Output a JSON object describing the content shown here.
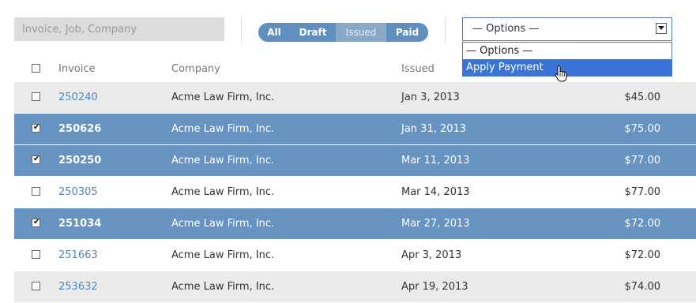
{
  "search": {
    "placeholder": "Invoice, Job, Company"
  },
  "filters": [
    {
      "label": "All",
      "active": false
    },
    {
      "label": "Draft",
      "active": false
    },
    {
      "label": "Issued",
      "active": true
    },
    {
      "label": "Paid",
      "active": false
    }
  ],
  "options": {
    "selected": "— Options —",
    "items": [
      "— Options —",
      "Apply Payment"
    ],
    "highlighted": "Apply Payment"
  },
  "columns": {
    "invoice": "Invoice",
    "company": "Company",
    "issued": "Issued"
  },
  "rows": [
    {
      "checked": false,
      "invoice": "250240",
      "company": "Acme Law Firm, Inc.",
      "issued": "Jan 3, 2013",
      "amount": "$45.00"
    },
    {
      "checked": true,
      "invoice": "250626",
      "company": "Acme Law Firm, Inc.",
      "issued": "Jan 31, 2013",
      "amount": "$75.00"
    },
    {
      "checked": true,
      "invoice": "250250",
      "company": "Acme Law Firm, Inc.",
      "issued": "Mar 11, 2013",
      "amount": "$77.00"
    },
    {
      "checked": false,
      "invoice": "250305",
      "company": "Acme Law Firm, Inc.",
      "issued": "Mar 14, 2013",
      "amount": "$77.00"
    },
    {
      "checked": true,
      "invoice": "251034",
      "company": "Acme Law Firm, Inc.",
      "issued": "Mar 27, 2013",
      "amount": "$72.00"
    },
    {
      "checked": false,
      "invoice": "251663",
      "company": "Acme Law Firm, Inc.",
      "issued": "Apr 3, 2013",
      "amount": "$72.00"
    },
    {
      "checked": false,
      "invoice": "253632",
      "company": "Acme Law Firm, Inc.",
      "issued": "Apr 19, 2013",
      "amount": "$74.00"
    }
  ],
  "colors": {
    "accent": "#6793c0",
    "link": "#4f86c0",
    "stripe": "#ebebeb",
    "highlight": "#3b74d8"
  }
}
